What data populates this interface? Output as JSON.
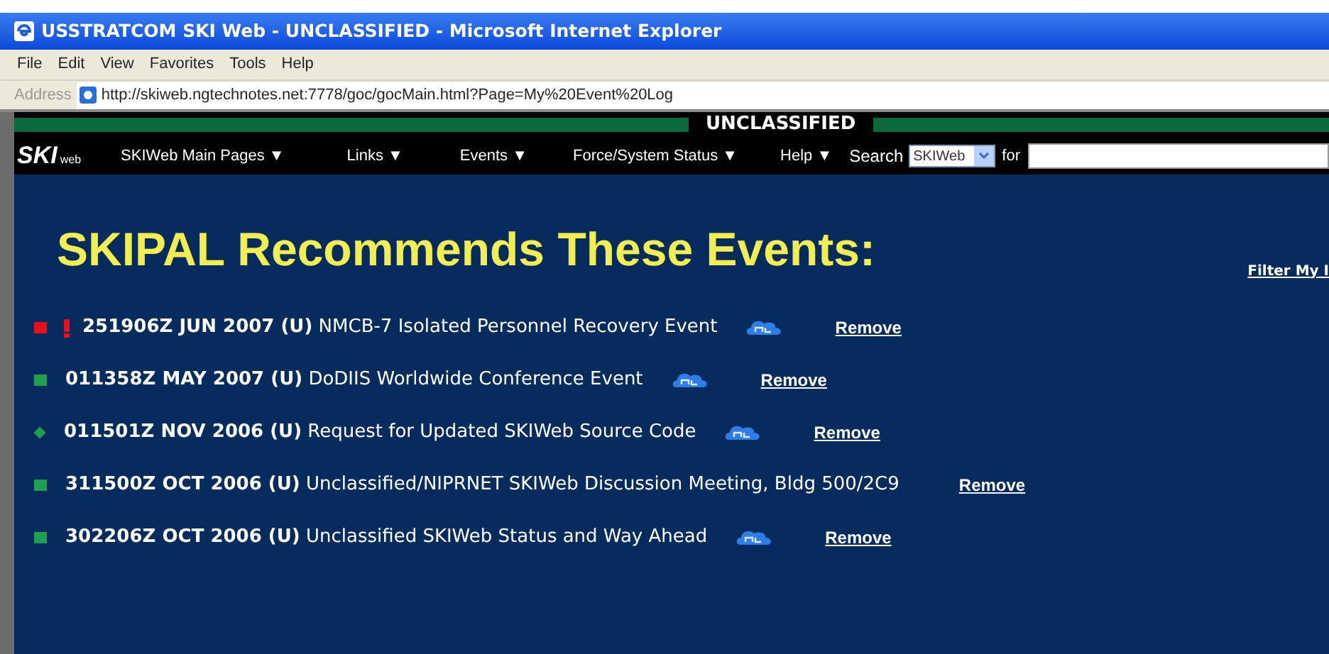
{
  "window": {
    "title": "USSTRATCOM SKI Web - UNCLASSIFIED - Microsoft Internet Explorer"
  },
  "menu": [
    "File",
    "Edit",
    "View",
    "Favorites",
    "Tools",
    "Help"
  ],
  "address_bar": {
    "label": "Address",
    "url": "http://skiweb.ngtechnotes.net:7778/goc/gocMain.html?Page=My%20Event%20Log"
  },
  "classification": "UNCLASSIFIED",
  "nav": {
    "logo": "SKI",
    "logo_sub": "web",
    "items": [
      "SKIWeb Main Pages ▼",
      "Links ▼",
      "Events ▼",
      "Force/System Status ▼",
      "Help ▼"
    ],
    "search_label": "Search",
    "search_scope": "SKIWeb",
    "for_label": "for"
  },
  "heading": "SKIPAL Recommends These Events:",
  "filter_link": "Filter My I",
  "events": [
    {
      "kind": "square",
      "color": "#e8101a",
      "urgent": true,
      "dtg": "251906Z JUN 2007 (U)",
      "title": "NMCB-7 Isolated Personnel Recovery Event",
      "new": true,
      "action": "Remove"
    },
    {
      "kind": "square",
      "color": "#1fa050",
      "urgent": false,
      "dtg": "011358Z MAY 2007 (U)",
      "title": "DoDIIS Worldwide Conference Event",
      "new": true,
      "action": "Remove"
    },
    {
      "kind": "diamond",
      "color": "#1fa050",
      "urgent": false,
      "dtg": "011501Z NOV 2006 (U)",
      "title": "Request for Updated SKIWeb Source Code",
      "new": true,
      "action": "Remove"
    },
    {
      "kind": "square",
      "color": "#1fa050",
      "urgent": false,
      "dtg": "311500Z OCT 2006 (U)",
      "title": "Unclassified/NIPRNET SKIWeb Discussion Meeting, Bldg 500/2C9",
      "new": false,
      "action": "Remove"
    },
    {
      "kind": "square",
      "color": "#1fa050",
      "urgent": false,
      "dtg": "302206Z OCT 2006 (U)",
      "title": "Unclassified SKIWeb Status and Way Ahead",
      "new": true,
      "action": "Remove"
    }
  ]
}
